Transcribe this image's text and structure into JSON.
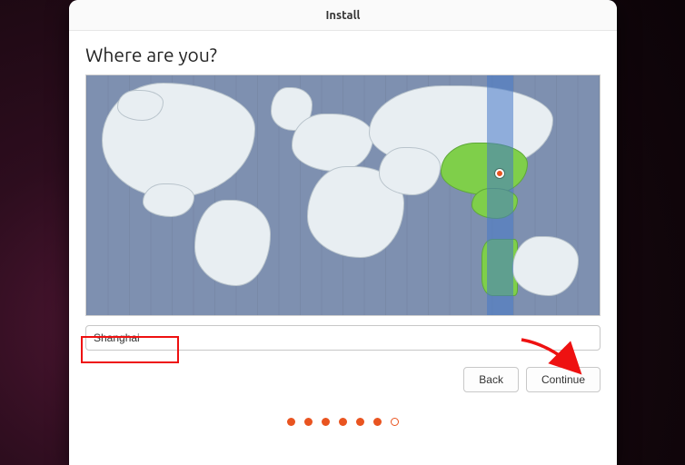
{
  "window": {
    "title": "Install"
  },
  "page": {
    "heading": "Where are you?",
    "timezone_value": "Shanghai"
  },
  "buttons": {
    "back": "Back",
    "continue": "Continue"
  },
  "progress": {
    "total": 7,
    "current": 6
  },
  "map": {
    "selected_region_label": "Shanghai",
    "highlighted_timezone_band_left_pct": 78,
    "pin": {
      "left_pct": 80.5,
      "top_pct": 41
    }
  }
}
